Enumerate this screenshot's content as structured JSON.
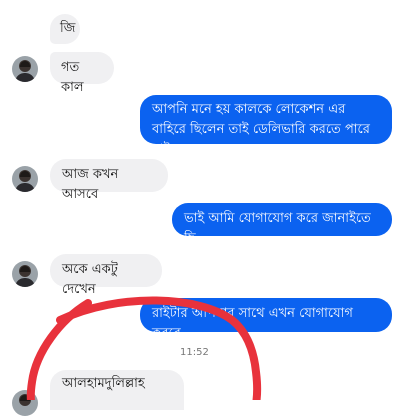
{
  "chat": {
    "messages": [
      {
        "text": "জি"
      },
      {
        "text": "গত কাল"
      },
      {
        "text": "আপনি মনে হয় কালকে লোকেশন এর বাহিরে ছিলেন তাই ডেলিভারি করতে পারে নাই"
      },
      {
        "text": "আজ কখন আসবে"
      },
      {
        "text": "ভাই আমি যোগাযোগ করে জানাইতে ছি"
      },
      {
        "text": "অকে একটু দেখেন"
      },
      {
        "text": "রাইটার আপনার সাথে এখন যোগাযোগ করবে"
      },
      {
        "text": "আলহামদুলিল্লাহ"
      }
    ],
    "timestamp": "11:52"
  },
  "colors": {
    "incoming_bubble": "#f0f0f2",
    "outgoing_bubble": "#0b62f0",
    "annotation": "#e8323c"
  }
}
